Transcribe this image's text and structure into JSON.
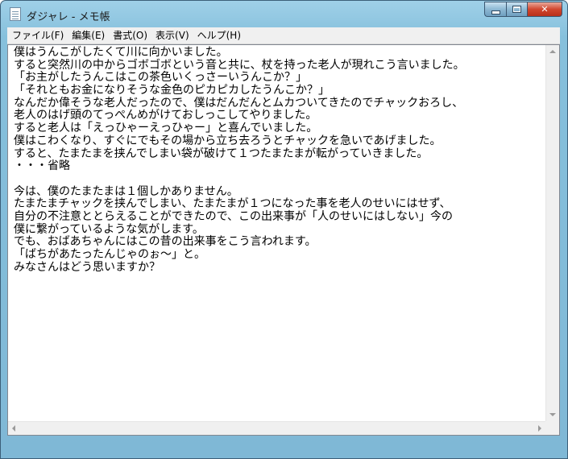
{
  "window": {
    "title": "ダジャレ - メモ帳"
  },
  "menu": {
    "items": [
      {
        "label": "ファイル(F)"
      },
      {
        "label": "編集(E)"
      },
      {
        "label": "書式(O)"
      },
      {
        "label": "表示(V)"
      },
      {
        "label": "ヘルプ(H)"
      }
    ]
  },
  "document": {
    "lines": [
      "僕はうんこがしたくて川に向かいました。",
      "すると突然川の中からゴボゴボという音と共に、杖を持った老人が現れこう言いました。",
      "「お主がしたうんこはこの茶色いくっさーいうんこか？」",
      "「それともお金になりそうな金色のピカピカしたうんこか？」",
      "なんだか偉そうな老人だったので、僕はだんだんとムカついてきたのでチャックおろし、",
      "老人のはげ頭のてっぺんめがけておしっこしてやりました。",
      "すると老人は「えっひゃーえっひゃー」と喜んでいました。",
      "僕はこわくなり、すぐにでもその場から立ち去ろうとチャックを急いであげました。",
      "すると、たまたまを挟んでしまい袋が破けて１つたまたまが転がっていきました。",
      "・・・省略",
      "",
      "今は、僕のたまたまは１個しかありません。",
      "たまたまチャックを挟んでしまい、たまたまが１つになった事を老人のせいにはせず、",
      "自分の不注意ととらえることができたので、この出来事が「人のせいにはしない」今の",
      "僕に繋がっているような気がします。",
      "でも、おばあちゃんにはこの昔の出来事をこう言われます。",
      "「ばちがあたったんじゃのぉ～」と。",
      "みなさんはどう思いますか？"
    ]
  }
}
